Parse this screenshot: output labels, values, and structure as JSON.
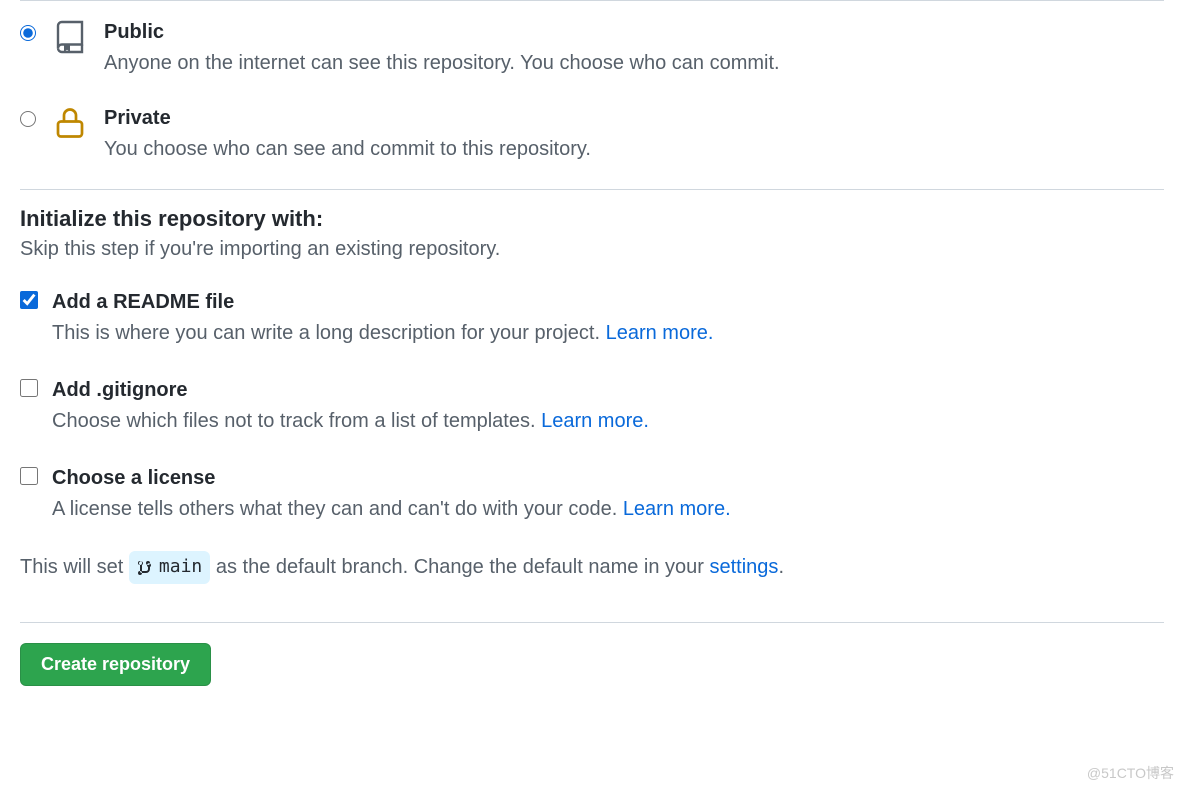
{
  "visibility": {
    "public": {
      "title": "Public",
      "desc": "Anyone on the internet can see this repository. You choose who can commit."
    },
    "private": {
      "title": "Private",
      "desc": "You choose who can see and commit to this repository."
    }
  },
  "init": {
    "heading": "Initialize this repository with:",
    "sub": "Skip this step if you're importing an existing repository.",
    "readme": {
      "title": "Add a README file",
      "desc_pre": "This is where you can write a long description for your project. ",
      "learn_more": "Learn more."
    },
    "gitignore": {
      "title": "Add .gitignore",
      "desc_pre": "Choose which files not to track from a list of templates. ",
      "learn_more": "Learn more."
    },
    "license": {
      "title": "Choose a license",
      "desc_pre": "A license tells others what they can and can't do with your code. ",
      "learn_more": "Learn more."
    }
  },
  "branch_info": {
    "pre": "This will set ",
    "branch": "main",
    "mid": " as the default branch. Change the default name in your ",
    "settings": "settings",
    "post": "."
  },
  "submit": {
    "label": "Create repository"
  },
  "watermark": "@51CTO博客"
}
